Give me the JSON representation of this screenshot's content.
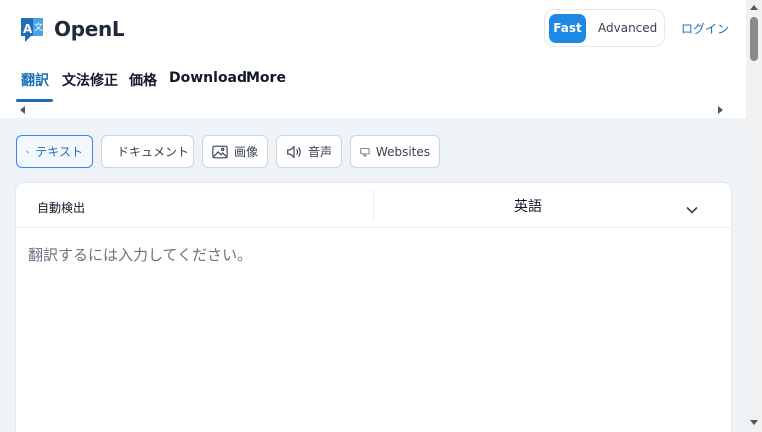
{
  "app": {
    "logo_text": "OpenL",
    "brand_color": "#1e6fb8",
    "accent_color": "#1e88e5"
  },
  "header": {
    "mode_fast": "Fast",
    "mode_advanced": "Advanced",
    "login": "ログイン"
  },
  "nav": {
    "items": [
      {
        "label": "翻訳",
        "active": true
      },
      {
        "label": "文法修正"
      },
      {
        "label": "価格"
      },
      {
        "label": "Download"
      },
      {
        "label": "More"
      }
    ]
  },
  "input_types": [
    {
      "label": "テキスト",
      "icon": "translate-icon",
      "active": true
    },
    {
      "label": "ドキュメント",
      "icon": "document-icon"
    },
    {
      "label": "画像",
      "icon": "image-icon"
    },
    {
      "label": "音声",
      "icon": "speaker-icon"
    },
    {
      "label": "Websites",
      "icon": "monitor-icon"
    }
  ],
  "translator": {
    "source_lang": "自動検出",
    "target_lang": "英語",
    "source_placeholder": "翻訳するには入力してください。"
  }
}
